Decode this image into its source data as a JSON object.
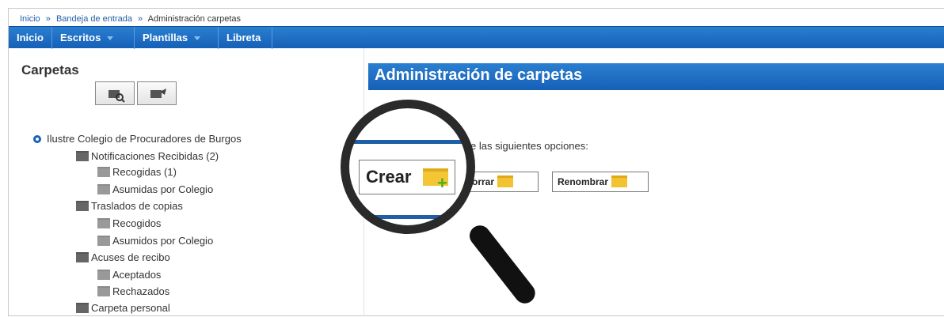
{
  "breadcrumb": {
    "items": [
      "Inicio",
      "Bandeja de entrada",
      "Administración carpetas"
    ],
    "separator": "»"
  },
  "menu": {
    "items": [
      {
        "label": "Inicio"
      },
      {
        "label": "Escritos"
      },
      {
        "label": "Plantillas"
      },
      {
        "label": "Libreta"
      }
    ]
  },
  "left": {
    "title": "Carpetas",
    "tree": {
      "root": "Ilustre Colegio de Procuradores de Burgos",
      "notificaciones": "Notificaciones Recibidas (2)",
      "recogidas": "Recogidas (1)",
      "asumidas": "Asumidas por Colegio",
      "traslados": "Traslados de copias",
      "recogidos": "Recogidos",
      "asumidos": "Asumidos por Colegio",
      "acuses": "Acuses de recibo",
      "aceptados": "Aceptados",
      "rechazados": "Rechazados",
      "personal": "Carpeta personal"
    }
  },
  "right": {
    "title": "Administración de carpetas",
    "options_text": "e las siguientes opciones:",
    "borrar_label": "orrar",
    "renombrar_label": "Renombrar"
  },
  "magnifier": {
    "crear_label": "Crear"
  },
  "colors": {
    "accent": "#1660b8",
    "folder": "#f2c230"
  }
}
